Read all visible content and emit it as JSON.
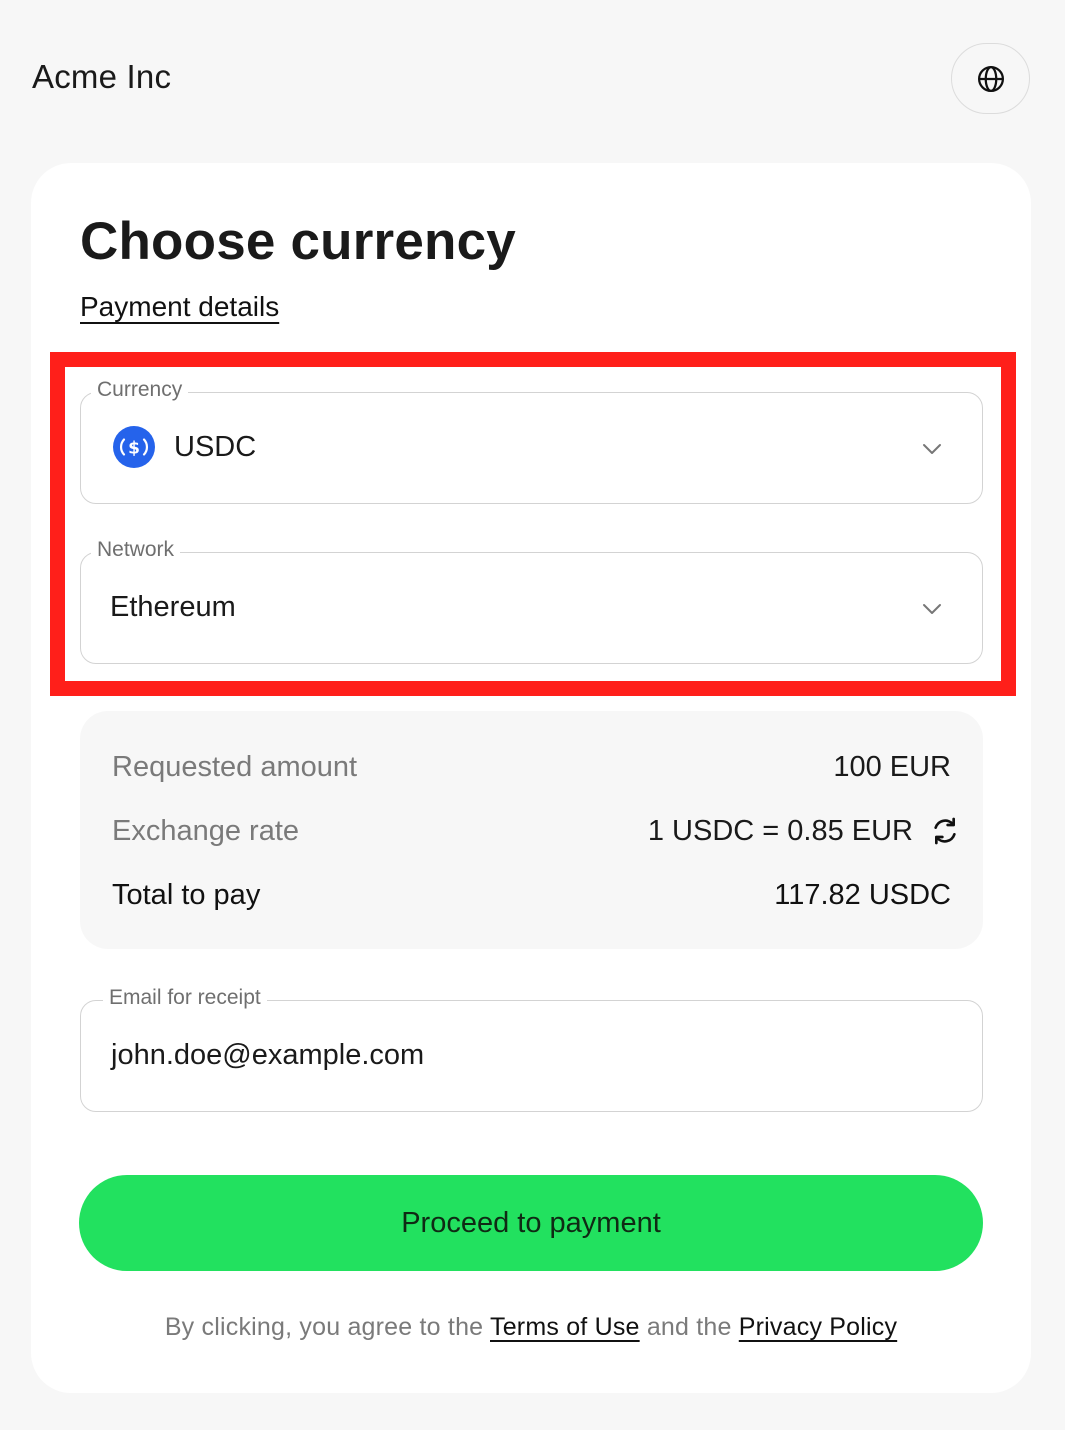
{
  "header": {
    "merchant_name": "Acme Inc",
    "language_icon": "globe-icon"
  },
  "card": {
    "title": "Choose currency",
    "payment_details_link": "Payment details"
  },
  "currency_field": {
    "label": "Currency",
    "value": "USDC",
    "icon": "usdc-coin-icon",
    "icon_color": "#2563eb"
  },
  "network_field": {
    "label": "Network",
    "value": "Ethereum"
  },
  "summary": {
    "requested_label": "Requested amount",
    "requested_value": "100 EUR",
    "rate_label": "Exchange rate",
    "rate_value": "1 USDC = 0.85 EUR",
    "total_label": "Total to pay",
    "total_value": "117.82 USDC"
  },
  "email_field": {
    "label": "Email for receipt",
    "value": "john.doe@example.com"
  },
  "actions": {
    "proceed_label": "Proceed to payment",
    "proceed_color": "#22e15f"
  },
  "legal": {
    "prefix": "By clicking, you agree to the",
    "terms_link": "Terms of Use",
    "middle": "and the",
    "privacy_link": "Privacy Policy"
  },
  "highlight_color": "#ff1f1a"
}
